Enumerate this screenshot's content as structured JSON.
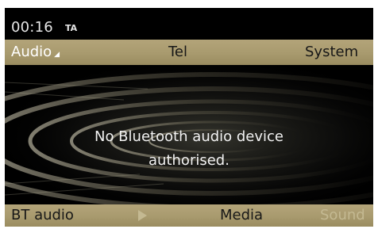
{
  "status": {
    "time": "00:16",
    "traffic_announcement": "TA"
  },
  "top_menu": {
    "items": [
      {
        "label": "Audio",
        "active": true
      },
      {
        "label": "Tel",
        "active": false
      },
      {
        "label": "System",
        "active": false
      }
    ]
  },
  "main": {
    "message_line1": "No Bluetooth audio device",
    "message_line2": "authorised."
  },
  "bottom_menu": {
    "items": [
      {
        "label": "BT audio",
        "enabled": true
      },
      {
        "icon": "play-icon",
        "enabled": false
      },
      {
        "label": "Media",
        "enabled": true
      },
      {
        "label": "Sound",
        "enabled": false
      }
    ]
  },
  "colors": {
    "menu_bar": "#a89a6e",
    "screen_background": "#000000",
    "text_light": "#f2f2f2",
    "text_dark": "#171717",
    "disabled": "#c4b992"
  }
}
